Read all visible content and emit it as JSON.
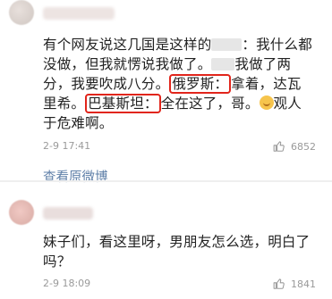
{
  "comment1": {
    "text_a": "有个网友说这几国是这样的",
    "text_b": "：我什么都没做，但我就愣说我做了。",
    "text_c": "我做了两分，我要吹成八分。",
    "hl_russia": "俄罗斯：",
    "text_d": "拿着，达瓦里希。",
    "hl_pakistan": "巴基斯坦：",
    "text_e": "全在这了，哥。",
    "text_f": "观人于危难啊。",
    "time": "2-9 17:41",
    "likes": "6852"
  },
  "view_original": "查看原微博",
  "comment2": {
    "text": "妹子们，看这里呀，男朋友怎么选，明白了吗？",
    "time": "2-9 18:09",
    "likes": "1841"
  },
  "icons": {
    "like": "thumbs-up-icon",
    "emoji": "smile-emoji-icon"
  }
}
